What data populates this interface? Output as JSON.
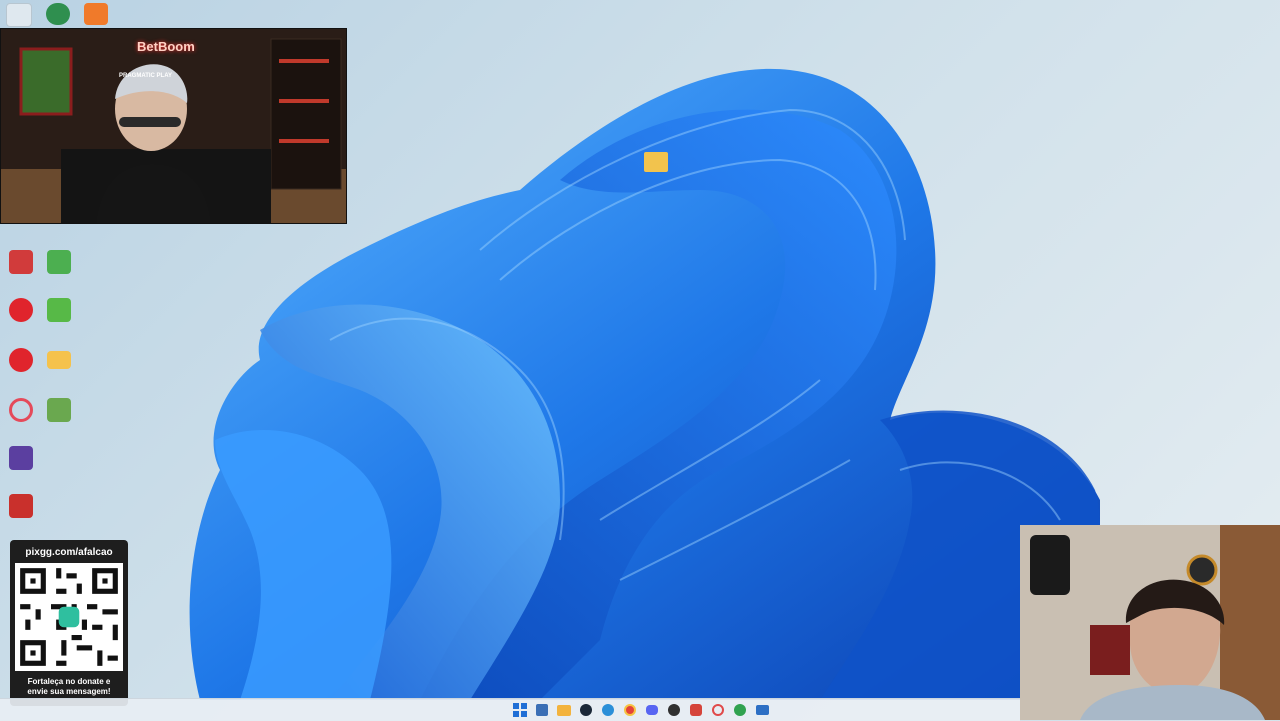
{
  "desktop": {
    "top_icons": [
      {
        "name": "recycle-bin-icon",
        "color": "#dfe8ef"
      },
      {
        "name": "streaming-app-icon",
        "color": "#2f8f4f"
      },
      {
        "name": "brand-a-icon",
        "color": "#f07a2a"
      }
    ],
    "icons": [
      {
        "name": "valorant-icon",
        "color": "#d13b3b",
        "label": ""
      },
      {
        "name": "bluestacks-icon",
        "color": "#4caf50",
        "label": ""
      },
      {
        "name": "riot-client-icon",
        "color": "#e0242c",
        "label": ""
      },
      {
        "name": "app-green-icon",
        "color": "#57b947",
        "label": ""
      },
      {
        "name": "riot-client-2-icon",
        "color": "#e0242c",
        "label": ""
      },
      {
        "name": "folder-icon",
        "color": "#f5c24c",
        "label": ""
      },
      {
        "name": "opera-gx-icon",
        "color": "#e54a5a",
        "label": ""
      },
      {
        "name": "app-map-icon",
        "color": "#6aa84f",
        "label": ""
      },
      {
        "name": "app-purple-icon",
        "color": "#5b3fa0",
        "label": ""
      },
      {
        "name": "app-red-icon",
        "color": "#c9302c",
        "label": ""
      }
    ],
    "center_folder": {
      "name": "folder-icon",
      "color": "#f2c34d"
    }
  },
  "webcam_top": {
    "brand_text": "BetBoom",
    "sponsor_text": "PRAGMATIC PLAY"
  },
  "qr_panel": {
    "url": "pixgg.com/afalcao",
    "message_line1": "Fortaleça no donate e",
    "message_line2": "envie sua mensagem!"
  },
  "taskbar": {
    "icons": [
      {
        "name": "start-icon",
        "color": "#1f6fd6"
      },
      {
        "name": "search-icon",
        "color": "#3b6fb5"
      },
      {
        "name": "file-explorer-icon",
        "color": "#f3b33d"
      },
      {
        "name": "steam-icon",
        "color": "#1b2838"
      },
      {
        "name": "edge-icon",
        "color": "#2b8fd8"
      },
      {
        "name": "chrome-icon",
        "color": "#e4433a"
      },
      {
        "name": "discord-icon",
        "color": "#5865f2"
      },
      {
        "name": "obs-icon",
        "color": "#303030"
      },
      {
        "name": "app-icon",
        "color": "#d5443a"
      },
      {
        "name": "opera-icon",
        "color": "#e04a4a"
      },
      {
        "name": "chrome-2-icon",
        "color": "#30a24f"
      },
      {
        "name": "monitor-icon",
        "color": "#2d6fc4"
      }
    ]
  },
  "colors": {
    "wallpaper_blue": "#1d6fe0",
    "wallpaper_light": "#4aa3ff"
  }
}
